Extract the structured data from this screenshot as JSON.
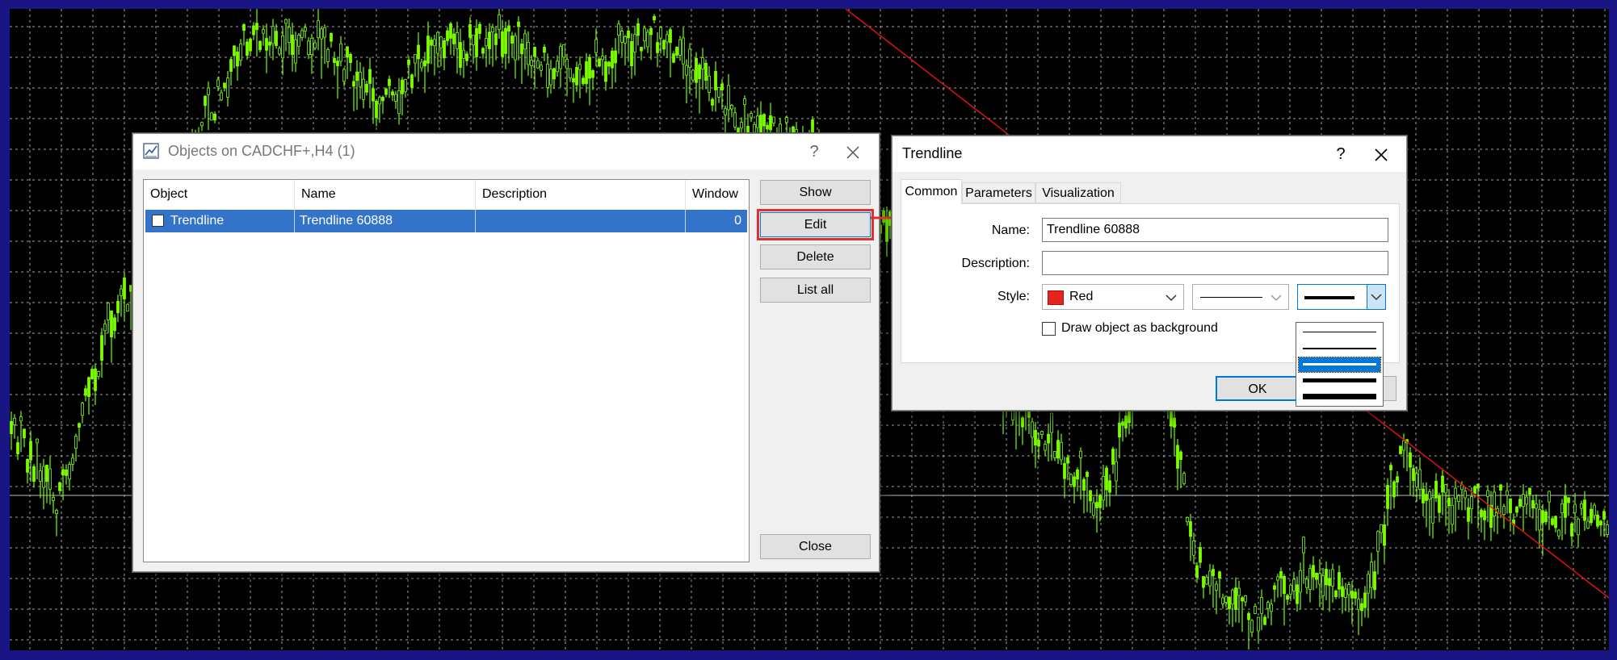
{
  "objects_dialog": {
    "title": "Objects on CADCHF+,H4 (1)",
    "help_glyph": "?",
    "columns": [
      "Object",
      "Name",
      "Description",
      "Window"
    ],
    "rows": [
      {
        "object": "Trendline",
        "name": "Trendline 60888",
        "description": "",
        "window": "0"
      }
    ],
    "buttons": {
      "show": "Show",
      "edit": "Edit",
      "delete": "Delete",
      "list_all": "List all",
      "close": "Close"
    }
  },
  "trendline_dialog": {
    "title": "Trendline",
    "help_glyph": "?",
    "tabs": [
      "Common",
      "Parameters",
      "Visualization"
    ],
    "active_tab": "Common",
    "fields": {
      "name_label": "Name:",
      "name_value": "Trendline 60888",
      "description_label": "Description:",
      "description_value": "",
      "style_label": "Style:",
      "color_value": "Red",
      "background_checkbox_label": "Draw object as background"
    },
    "ok_label": "OK",
    "width_options": [
      1,
      2,
      3,
      4,
      5
    ],
    "selected_width": 3
  },
  "icons": [
    "chart-icon",
    "help-icon",
    "close-icon",
    "chevron-down-icon",
    "arrow-icon"
  ],
  "colors": {
    "frame": "#1a1585",
    "chart_bg": "#000000",
    "grid": "#c8c8c8",
    "candles": "#7cfc00",
    "trendline": "#e01010",
    "selection": "#3373c9",
    "highlight_box": "#e03030",
    "swatch_red": "#e8231e"
  }
}
